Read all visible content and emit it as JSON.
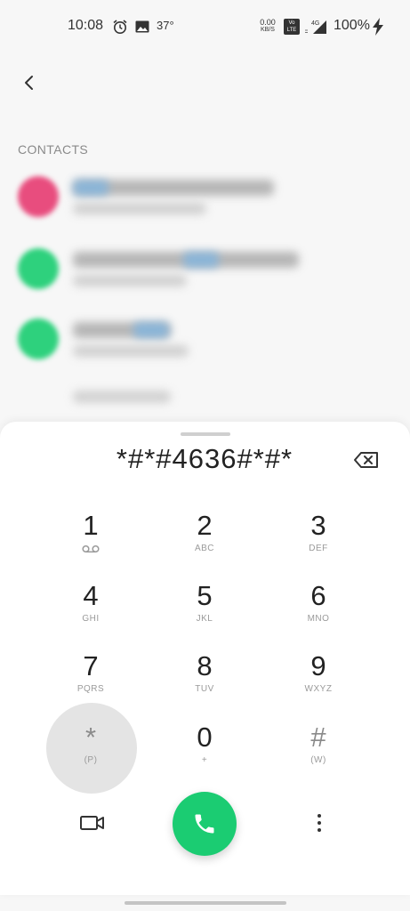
{
  "status_bar": {
    "time": "10:08",
    "temperature": "37°",
    "net_speed_value": "0.00",
    "net_speed_unit": "KB/S",
    "volte_label": "Vo LTE",
    "network_type": "4G",
    "battery": "100%",
    "icons": [
      "alarm-icon",
      "image-icon",
      "signal-icon",
      "charging-bolt-icon"
    ]
  },
  "contacts": {
    "header": "CONTACTS",
    "avatar_colors": [
      "#e84d7e",
      "#2ed17d",
      "#2ed17d"
    ]
  },
  "dialer": {
    "input_value": "*#*#4636#*#*",
    "keys": [
      {
        "digit": "1",
        "letters": ""
      },
      {
        "digit": "2",
        "letters": "ABC"
      },
      {
        "digit": "3",
        "letters": "DEF"
      },
      {
        "digit": "4",
        "letters": "GHI"
      },
      {
        "digit": "5",
        "letters": "JKL"
      },
      {
        "digit": "6",
        "letters": "MNO"
      },
      {
        "digit": "7",
        "letters": "PQRS"
      },
      {
        "digit": "8",
        "letters": "TUV"
      },
      {
        "digit": "9",
        "letters": "WXYZ"
      },
      {
        "digit": "*",
        "letters": "(P)"
      },
      {
        "digit": "0",
        "letters": "+"
      },
      {
        "digit": "#",
        "letters": "(W)"
      }
    ],
    "call_button_color": "#1bcc72"
  }
}
